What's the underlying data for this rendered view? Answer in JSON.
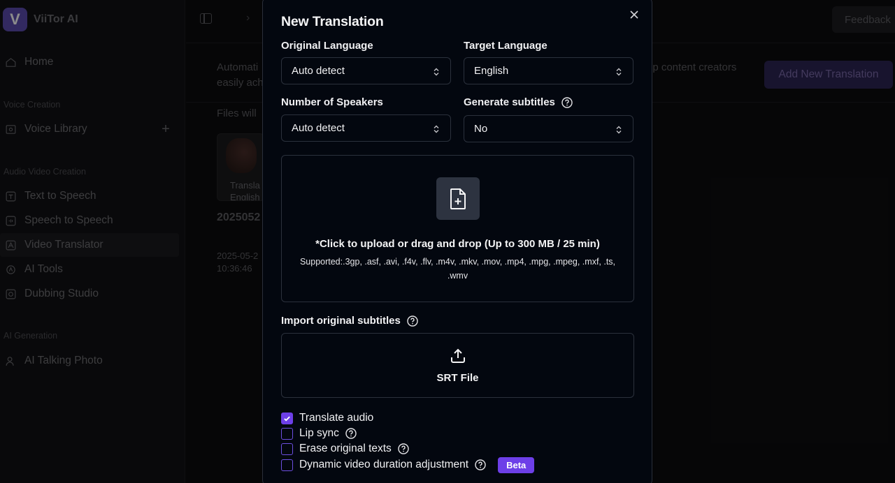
{
  "app": {
    "name": "ViiTor AI",
    "logo_letter": "V"
  },
  "sidebar": {
    "home": "Home",
    "section_voice": "Voice Creation",
    "voice_library": "Voice Library",
    "section_av": "Audio Video Creation",
    "items": [
      "Text to Speech",
      "Speech to Speech",
      "Video Translator",
      "AI Tools",
      "Dubbing Studio"
    ],
    "section_ai": "AI Generation",
    "talking_photo": "AI Talking Photo"
  },
  "topbar": {
    "feedback": "Feedback"
  },
  "background": {
    "desc_line1_left": "Automati",
    "desc_line2_left": "easily ach",
    "desc_right": "lp content creators",
    "add_button": "Add New Translation",
    "files_note": "Files will",
    "thumb_line1": "Transla",
    "thumb_line2": "English",
    "card_title": "2025052",
    "card_date": "2025-05-2",
    "card_time": "10:36:46"
  },
  "modal": {
    "title": "New Translation",
    "original_language": {
      "label": "Original Language",
      "value": "Auto detect"
    },
    "target_language": {
      "label": "Target Language",
      "value": "English"
    },
    "speakers": {
      "label": "Number of Speakers",
      "value": "Auto detect"
    },
    "subtitles": {
      "label": "Generate subtitles",
      "value": "No"
    },
    "upload": {
      "main": "*Click to upload or drag and drop (Up to 300 MB / 25 min)",
      "supported": "Supported:.3gp, .asf, .avi, .f4v, .flv, .m4v, .mkv, .mov, .mp4, .mpg, .mpeg, .mxf, .ts, .wmv"
    },
    "import_label": "Import original subtitles",
    "srt_label": "SRT File",
    "options": {
      "translate_audio": {
        "label": "Translate audio",
        "checked": true
      },
      "lip_sync": {
        "label": "Lip sync",
        "checked": false
      },
      "erase_texts": {
        "label": "Erase original texts",
        "checked": false
      },
      "dynamic_duration": {
        "label": "Dynamic video duration adjustment",
        "checked": false,
        "badge": "Beta"
      }
    }
  },
  "colors": {
    "accent": "#6d3fe8",
    "modal_bg": "#03070f",
    "border": "#2b313c"
  }
}
